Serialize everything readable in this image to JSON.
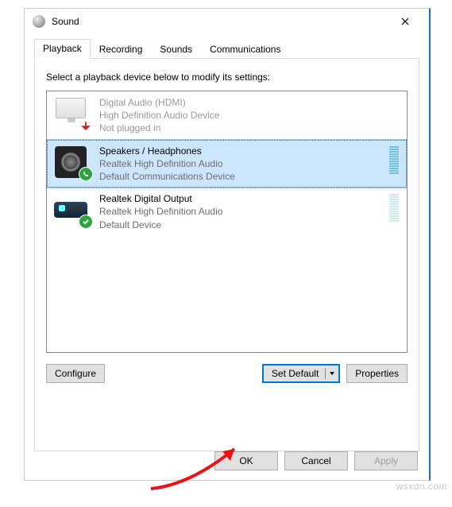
{
  "window": {
    "title": "Sound"
  },
  "tabs": {
    "playback": "Playback",
    "recording": "Recording",
    "sounds": "Sounds",
    "communications": "Communications"
  },
  "instruction": "Select a playback device below to modify its settings:",
  "devices": [
    {
      "name": "Digital Audio (HDMI)",
      "sub1": "High Definition Audio Device",
      "sub2": "Not plugged in"
    },
    {
      "name": "Speakers / Headphones",
      "sub1": "Realtek High Definition Audio",
      "sub2": "Default Communications Device"
    },
    {
      "name": "Realtek Digital Output",
      "sub1": "Realtek High Definition Audio",
      "sub2": "Default Device"
    }
  ],
  "buttons": {
    "configure": "Configure",
    "set_default": "Set Default",
    "properties": "Properties",
    "ok": "OK",
    "cancel": "Cancel",
    "apply": "Apply"
  },
  "watermark": "wsxdn.com"
}
